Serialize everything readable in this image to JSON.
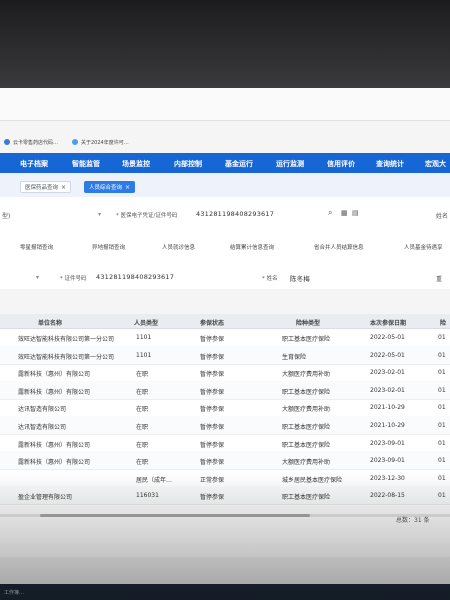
{
  "browser": {
    "tabs": [
      {
        "label": "云卡零售药店代码…",
        "color": "#3b7bd8"
      },
      {
        "label": "关于2024年度许可…",
        "color": "#4aa0e6"
      }
    ]
  },
  "nav": {
    "items": [
      "电子档案",
      "智能监管",
      "场景监控",
      "内部控制",
      "基金运行",
      "运行监测",
      "信用评价",
      "查询统计",
      "宏观大"
    ]
  },
  "page_tabs": [
    {
      "label": "医保药品查询"
    },
    {
      "label": "人员综合查询"
    }
  ],
  "filter1": {
    "left_label": "型)",
    "left_caret": "▾",
    "id_label": "* 医保电子凭证/证件号码",
    "id_value": "431281198408293617",
    "name_label": "姓名"
  },
  "subtabs": [
    "零星报销查询",
    "异地报销查询",
    "人员就诊信息",
    "结算累计信息查询",
    "省合并人员结算信息",
    "人员基金待遇享"
  ],
  "filter2": {
    "left_caret": "▾",
    "cert_label": "* 证件号码",
    "cert_value": "431281198408293617",
    "name_label": "* 姓名",
    "name_value": "陈冬梅",
    "reset_label": "重"
  },
  "table": {
    "columns": [
      "单位名称",
      "人员类型",
      "参保状态",
      "险种类型",
      "本次参保日期",
      "险"
    ],
    "rows": [
      {
        "unit": "效旺达智能科技有限公司第一分公司",
        "ptype": "1101",
        "status": "暂停参保",
        "insurance": "职工基本医疗保险",
        "date": "2022-05-01",
        "extra": "01"
      },
      {
        "unit": "效旺达智能科技有限公司第一分公司",
        "ptype": "1101",
        "status": "暂停参保",
        "insurance": "生育保险",
        "date": "2022-05-01",
        "extra": "01"
      },
      {
        "unit": "露新科技（惠州）有限公司",
        "ptype": "在职",
        "status": "暂停参保",
        "insurance": "大额医疗费用补助",
        "date": "2023-02-01",
        "extra": "01"
      },
      {
        "unit": "露新科技（惠州）有限公司",
        "ptype": "在职",
        "status": "暂停参保",
        "insurance": "职工基本医疗保险",
        "date": "2023-02-01",
        "extra": "01"
      },
      {
        "unit": "达讯智造有限公司",
        "ptype": "在职",
        "status": "暂停参保",
        "insurance": "大额医疗费用补助",
        "date": "2021-10-29",
        "extra": "01"
      },
      {
        "unit": "达讯智造有限公司",
        "ptype": "在职",
        "status": "暂停参保",
        "insurance": "职工基本医疗保险",
        "date": "2021-10-29",
        "extra": "01"
      },
      {
        "unit": "露新科技（惠州）有限公司",
        "ptype": "在职",
        "status": "暂停参保",
        "insurance": "职工基本医疗保险",
        "date": "2023-09-01",
        "extra": "01"
      },
      {
        "unit": "露新科技（惠州）有限公司",
        "ptype": "在职",
        "status": "暂停参保",
        "insurance": "大额医疗费用补助",
        "date": "2023-09-01",
        "extra": "01"
      },
      {
        "unit": "",
        "ptype": "居民（成年…",
        "status": "正常参保",
        "insurance": "城乡居民基本医疗保险",
        "date": "2023-12-30",
        "extra": "01"
      },
      {
        "unit": "盈企业管理有限公司",
        "ptype": "116031",
        "status": "暂停参保",
        "insurance": "职工基本医疗保险",
        "date": "2022-08-15",
        "extra": "01"
      }
    ]
  },
  "footer": {
    "total": "总数：31 条"
  },
  "taskbar": {
    "text": "工作簿…"
  },
  "colors": {
    "nav_bg": "#1766d6",
    "active_tab": "#2d7be5"
  }
}
